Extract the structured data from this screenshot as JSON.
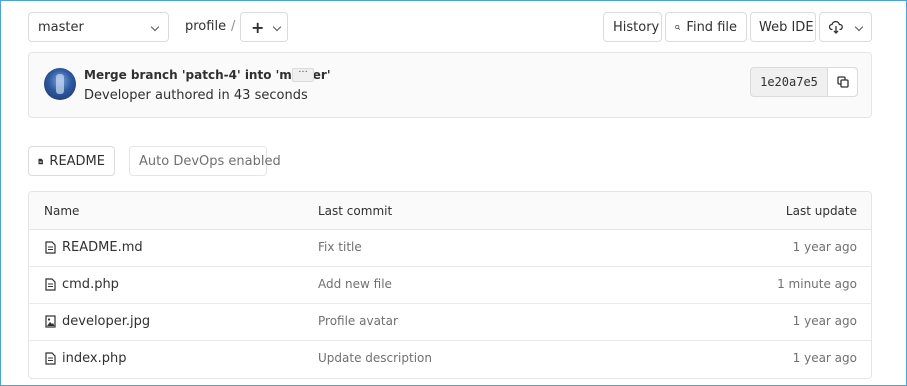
{
  "toolbar": {
    "branch": "master",
    "breadcrumb": "profile",
    "separator": "/",
    "plus": "+",
    "history": "History",
    "find_file": "Find file",
    "web_ide": "Web IDE"
  },
  "commit": {
    "title": "Merge branch 'patch-4' into 'master'",
    "ellipsis": "···",
    "meta": "Developer authored in 43 seconds",
    "sha": "1e20a7e5"
  },
  "actions": {
    "readme": "README",
    "devops": "Auto DevOps enabled"
  },
  "table": {
    "headers": {
      "name": "Name",
      "last_commit": "Last commit",
      "last_update": "Last update"
    },
    "rows": [
      {
        "name": "README.md",
        "message": "Fix title",
        "updated": "1 year ago",
        "icon": "file-text-icon"
      },
      {
        "name": "cmd.php",
        "message": "Add new file",
        "updated": "1 minute ago",
        "icon": "file-text-icon"
      },
      {
        "name": "developer.jpg",
        "message": "Profile avatar",
        "updated": "1 year ago",
        "icon": "file-image-icon"
      },
      {
        "name": "index.php",
        "message": "Update description",
        "updated": "1 year ago",
        "icon": "file-text-icon"
      }
    ]
  },
  "colors": {
    "border": "#dbdbdb",
    "muted": "#707070",
    "frame": "#4ca1d6"
  }
}
